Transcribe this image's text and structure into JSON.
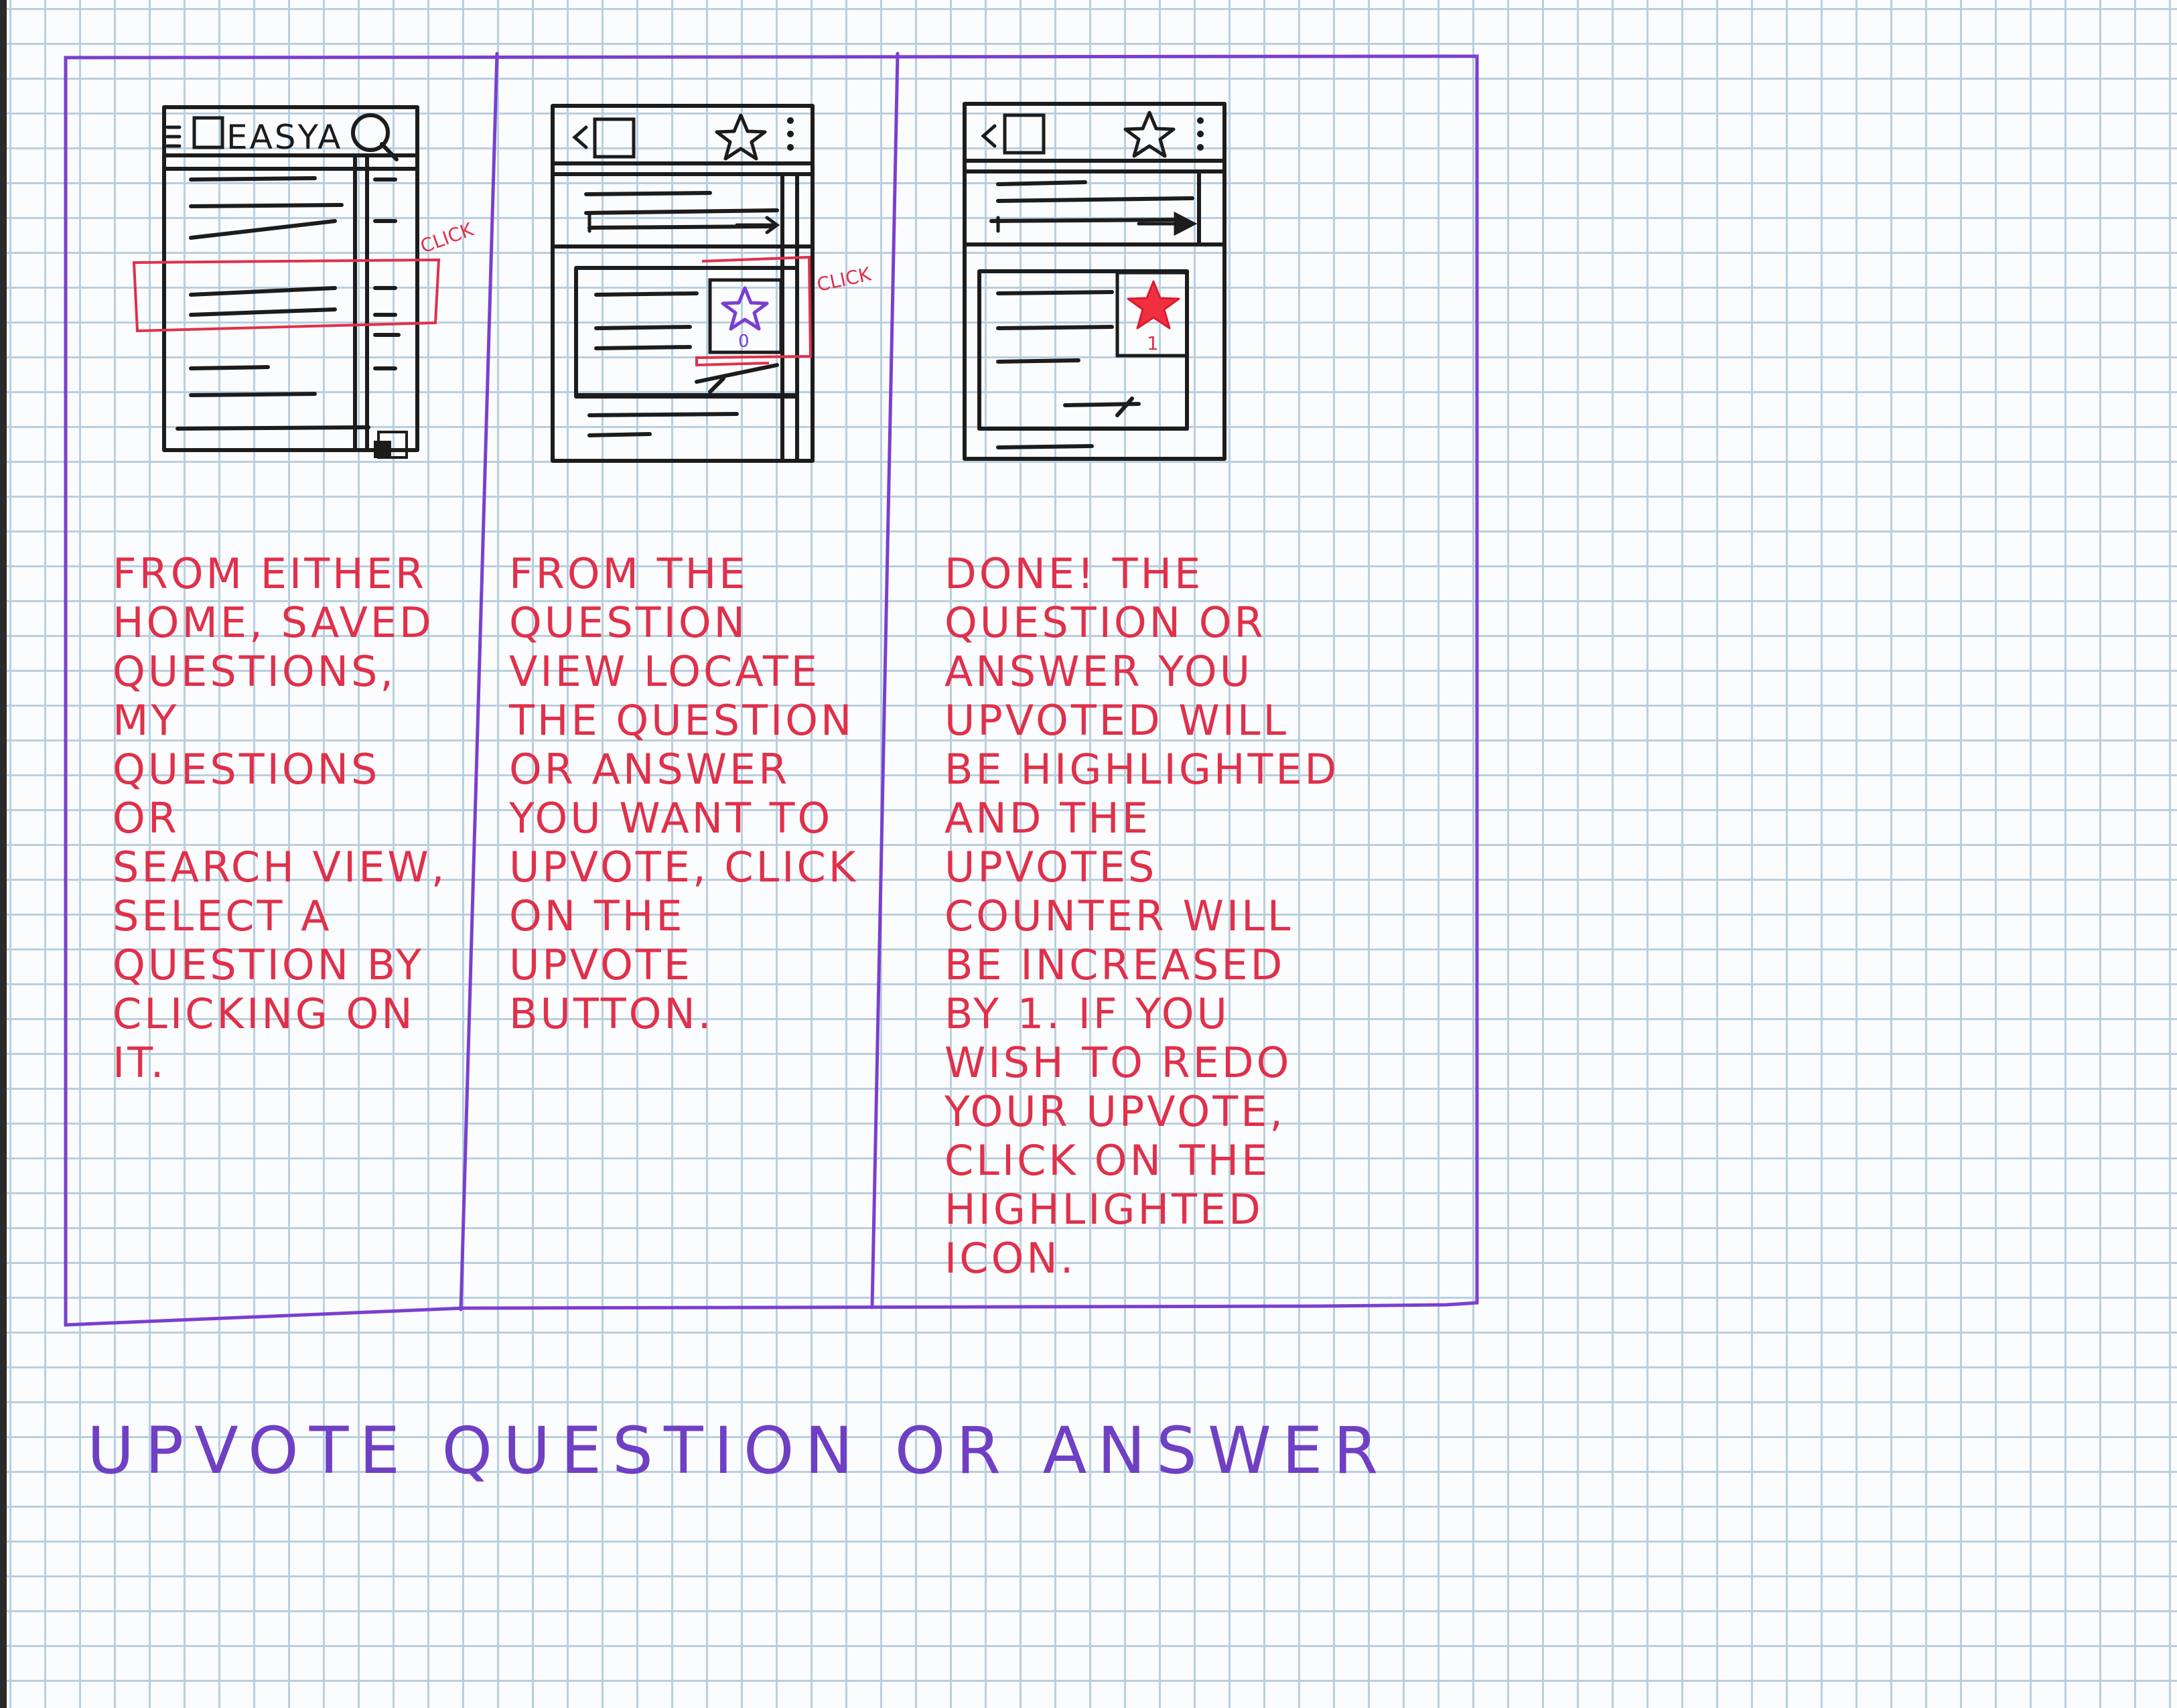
{
  "steps": [
    {
      "mockup": {
        "header_text": "EASYA",
        "annotation": "CLICK"
      },
      "caption": "FROM EITHER\nHOME, SAVED\nQUESTIONS, MY\nQUESTIONS OR\nSEARCH VIEW,\nSELECT A\nQUESTION BY\nCLICKING ON\nIT."
    },
    {
      "mockup": {
        "upvote_count": "0",
        "annotation": "CLICK"
      },
      "caption": "FROM THE\nQUESTION\nVIEW LOCATE\nTHE QUESTION\nOR ANSWER\nYOU WANT TO\nUPVOTE, CLICK\nON THE UPVOTE\nBUTTON."
    },
    {
      "mockup": {
        "upvote_count": "1"
      },
      "caption": "DONE! THE\nQUESTION OR\nANSWER YOU\nUPVOTED WILL\nBE HIGHLIGHTED\nAND THE UPVOTES\nCOUNTER WILL\nBE INCREASED\nBY 1. IF YOU\nWISH TO REDO\nYOUR UPVOTE,\nCLICK ON THE\nHIGHLIGHTED\nICON."
    }
  ],
  "title": "UPVOTE QUESTION OR ANSWER",
  "colors": {
    "frame": "#7a3fd0",
    "ink": "#1c1c1c",
    "annotation": "#e0304a",
    "highlight_star": "#f0303e"
  },
  "icons": [
    "menu-icon",
    "search-icon",
    "back-icon",
    "star-icon",
    "more-vertical-icon",
    "arrow-right-icon",
    "compose-icon"
  ]
}
